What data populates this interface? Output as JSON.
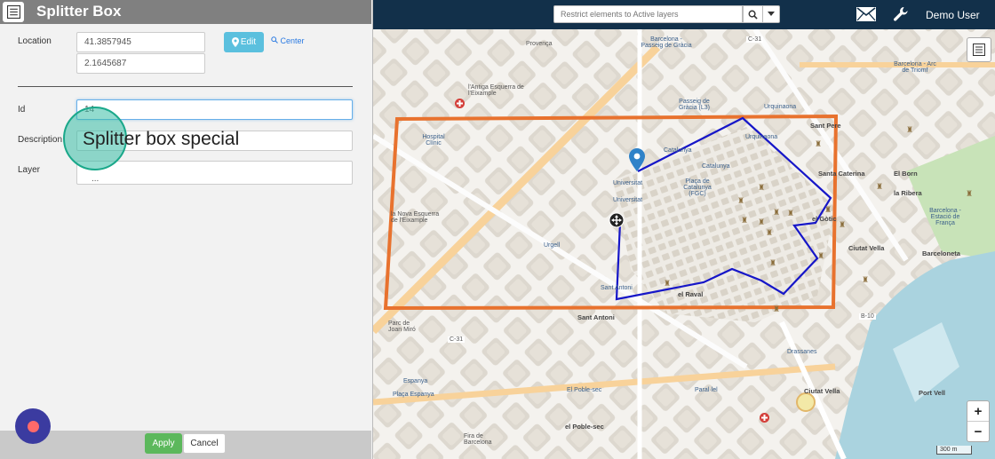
{
  "header": {
    "search_placeholder": "Restrict elements to Active layers",
    "user": "Demo User"
  },
  "panel": {
    "title": "Splitter Box",
    "location_label": "Location",
    "latitude": "41.3857945",
    "longitude": "2.1645687",
    "edit_label": "Edit",
    "center_label": "Center",
    "id_label": "Id",
    "id_value": "14",
    "description_label": "Description",
    "description_value": "Splitter box special",
    "layer_label": "Layer",
    "layer_value": "...",
    "apply_label": "Apply",
    "cancel_label": "Cancel"
  },
  "map": {
    "zoom_in": "+",
    "zoom_out": "−",
    "scale": "300 m",
    "labels": {
      "provenca": "Provença",
      "sagrada": "Barcelona - Passeig de Gràcia",
      "antiga": "l'Antiga Esquerra de l'Eixample",
      "passeig_gracia": "Passeig de Gràcia (L3)",
      "arc_triomf": "Barcelona - Arc de Triomf",
      "urquinaona": "Urquinaona",
      "hospital": "Hospital Clínic",
      "catalunya": "Catalunya",
      "placa_cat": "Plaça de Catalunya (FGC)",
      "universitat": "Universitat",
      "universitat2": "Universitat",
      "nova_esquerra": "la Nova Esquerra de l'Eixample",
      "urgell": "Urgell",
      "sant_antoni": "Sant Antoni",
      "sant_antoni2": "Sant Antoni",
      "el_raval": "el Raval",
      "gotic": "el Gòtic",
      "sant_pere": "Sant Pere",
      "born": "El Born",
      "ribera": "la Ribera",
      "estacio_franca": "Barcelona - Estació de França",
      "ciutat_vella": "Ciutat Vella",
      "barceloneta": "Barceloneta",
      "drassanes": "Drassanes",
      "parc_joan_miro": "Parc de Joan Miró",
      "espanya": "Espanya",
      "placa_espanya": "Plaça Espanya",
      "poble_sec": "El Poble-sec",
      "poble_sec2": "el Poble-sec",
      "paral_lel": "Paral·lel",
      "port_vell": "Port Vell",
      "fira": "Fira de Barcelona",
      "ciutat_vella2": "Ciutat Vella",
      "c31": "C-31",
      "c31b": "C-31",
      "b10": "B-10",
      "sant_cat": "Santa Caterina"
    }
  },
  "colors": {
    "navbar": "#12304a",
    "selection_rect": "#e8722e",
    "route": "#1616c8",
    "apply": "#5cb85c",
    "edit": "#5bc0de",
    "highlight": "#38bea5"
  }
}
